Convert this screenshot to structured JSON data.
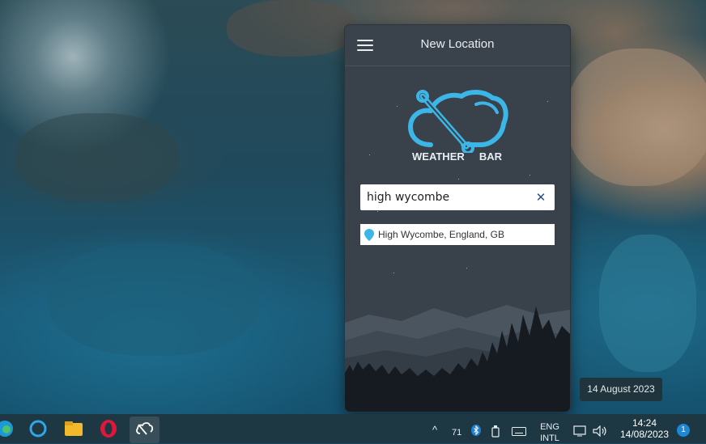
{
  "app": {
    "header_title": "New Location",
    "logo_word_left": "WEATHER",
    "logo_word_right": "BAR",
    "search": {
      "value": "high wycombe",
      "placeholder": "",
      "clear_glyph": "✕"
    },
    "suggestion": {
      "label": "High Wycombe, England, GB",
      "icon": "map-pin-icon"
    },
    "accent_color": "#3bb6e6"
  },
  "desktop": {
    "date_tooltip": "14 August 2023"
  },
  "taskbar": {
    "pinned_icons": [
      "edge-icon",
      "cortana-icon",
      "file-explorer-icon",
      "opera-icon",
      "weather-bar-icon"
    ],
    "tray": {
      "chevron": "^",
      "temperature": "71",
      "language_line1": "ENG",
      "language_line2": "INTL",
      "time": "14:24",
      "date": "14/08/2023",
      "notification_count": "1"
    }
  }
}
